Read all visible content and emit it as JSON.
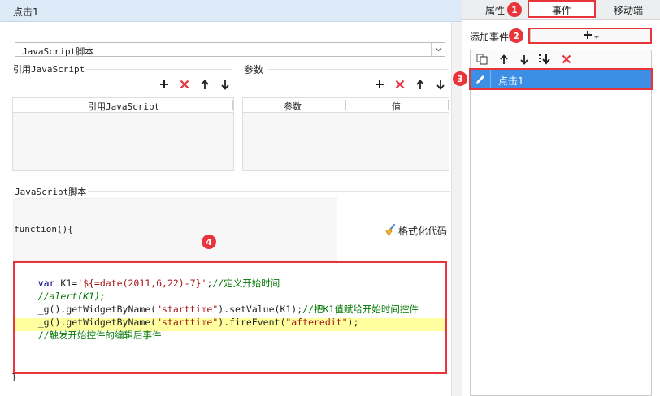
{
  "left": {
    "title": "点击1",
    "script_type_select": "JavaScript脚本",
    "ref_js": {
      "label": "引用JavaScript",
      "column": "引用JavaScript"
    },
    "params": {
      "label": "参数",
      "columns": [
        "参数",
        "值"
      ]
    },
    "script_section_label": "JavaScript脚本",
    "function_header": "function(){",
    "format_button": "格式化代码",
    "closing_brace": "}",
    "code": {
      "line1_kw": "var",
      "line1_a": " K1=",
      "line1_str": "'${=date(2011,6,22)-7}'",
      "line1_b": ";",
      "line1_cm": "//定义开始时间",
      "line2_cm": "//alert(K1);",
      "line3_a": "_g().getWidgetByName(",
      "line3_str": "\"starttime\"",
      "line3_b": ").setValue(K1);",
      "line3_cm": "//把K1值赋给开始时间控件",
      "line4_a": "_g().getWidgetByName(",
      "line4_str": "\"starttime\"",
      "line4_b": ").fireEvent(",
      "line4_str2": "\"afteredit\"",
      "line4_c": ");",
      "line5_cm": "//触发开始控件的编辑后事件"
    }
  },
  "right": {
    "tabs": [
      "属性",
      "事件",
      "移动端"
    ],
    "active_tab": "事件",
    "add_event_label": "添加事件",
    "add_button": "+",
    "event_item": "点击1"
  },
  "badges": [
    "1",
    "2",
    "3",
    "4"
  ],
  "colors": {
    "accent_blue": "#3399ee",
    "selected_row": "#3d8fe6",
    "highlight_red": "#e8343b",
    "header_bg": "#dcebf7",
    "code_highlight": "#ffffa0"
  }
}
